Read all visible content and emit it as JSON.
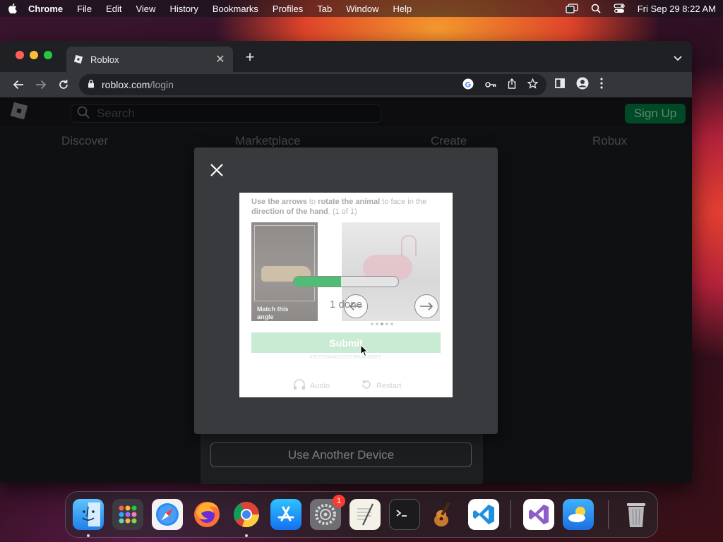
{
  "menubar": {
    "app_name": "Chrome",
    "items": [
      "File",
      "Edit",
      "View",
      "History",
      "Bookmarks",
      "Profiles",
      "Tab",
      "Window",
      "Help"
    ],
    "clock": "Fri Sep 29  8:22 AM"
  },
  "browser": {
    "tab_title": "Roblox",
    "url_host": "roblox.com",
    "url_path": "/login"
  },
  "roblox": {
    "search_placeholder": "Search",
    "signup_label": "Sign Up",
    "nav": [
      "Discover",
      "Marketplace",
      "Create",
      "Robux"
    ],
    "another_device_label": "Use Another Device"
  },
  "captcha": {
    "instruction_part1": "Use the arrows",
    "instruction_part2": " to ",
    "instruction_part3": "rotate the animal",
    "instruction_part4": " to face in the ",
    "instruction_part5": "direction of the hand",
    "instruction_counter": ". (1 of 1)",
    "reference_label": "Match this angle",
    "submit_label": "Submit",
    "session_id": "62E7D504AB1C57E2FA8A70DE3",
    "audio_label": "Audio",
    "restart_label": "Restart",
    "progress_text": "1 done",
    "progress_fraction": 0.45
  },
  "dock": {
    "settings_badge": "1"
  },
  "colors": {
    "signup_green": "#00703c",
    "progress_green": "#4fbe74",
    "badge_red": "#ff3b30"
  }
}
